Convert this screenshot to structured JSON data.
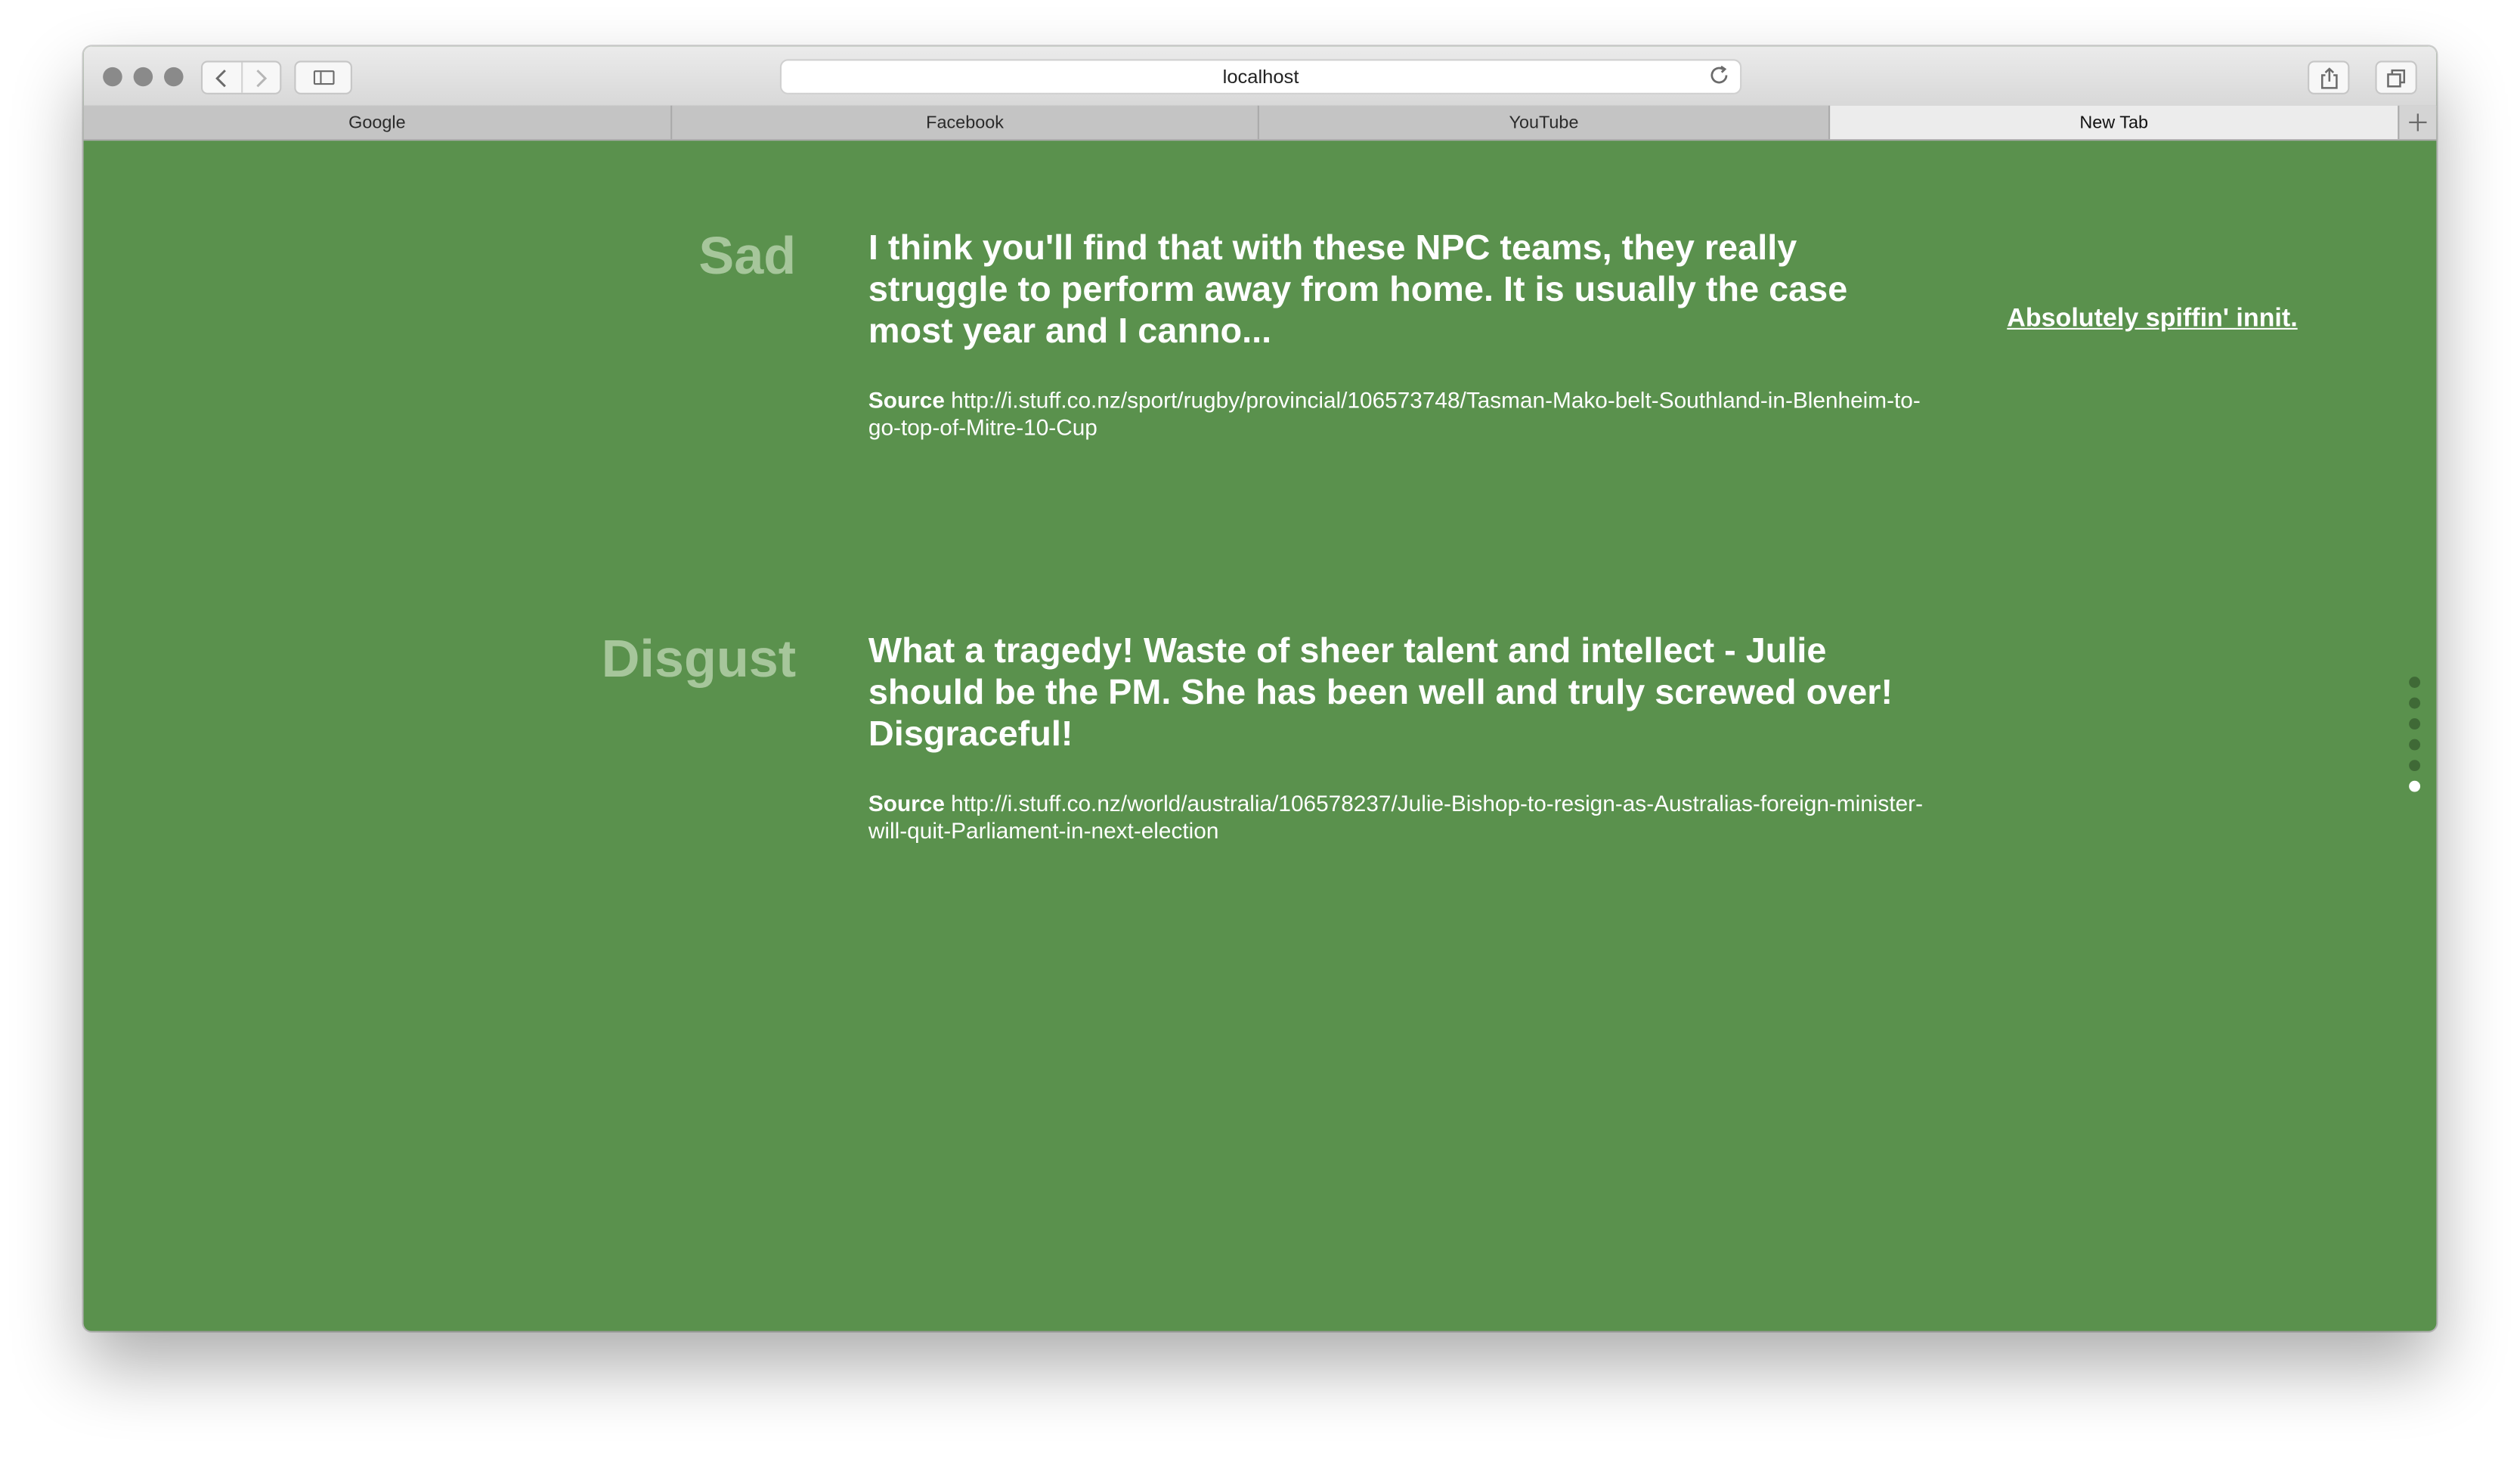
{
  "browser": {
    "url": "localhost",
    "tabs": [
      {
        "label": "Google",
        "active": false
      },
      {
        "label": "Facebook",
        "active": false
      },
      {
        "label": "YouTube",
        "active": false
      },
      {
        "label": "New Tab",
        "active": true
      }
    ]
  },
  "page": {
    "background_color": "#5a914d",
    "side_link": "Absolutely spiffin' innit.",
    "entries": [
      {
        "emotion": "Sad",
        "quote": "I think you'll find that with these NPC teams, they really struggle to perform away from home.  It is usually the case most year and I canno...",
        "source_label": "Source",
        "source_url": "http://i.stuff.co.nz/sport/rugby/provincial/106573748/Tasman-Mako-belt-Southland-in-Blenheim-to-go-top-of-Mitre-10-Cup"
      },
      {
        "emotion": "Disgust",
        "quote": "What a tragedy!  Waste of sheer talent and intellect - Julie should be the PM.  She has been well and truly screwed over! Disgraceful!",
        "source_label": "Source",
        "source_url": "http://i.stuff.co.nz/world/australia/106578237/Julie-Bishop-to-resign-as-Australias-foreign-minister-will-quit-Parliament-in-next-election"
      }
    ],
    "pagination": {
      "total": 6,
      "active_index": 5
    }
  },
  "icons": {
    "back": "chevron-left-icon",
    "forward": "chevron-right-icon",
    "sidebar": "sidebar-icon",
    "reload": "reload-icon",
    "share": "share-icon",
    "tabs_overview": "tabs-overview-icon",
    "new_tab": "plus-icon"
  }
}
